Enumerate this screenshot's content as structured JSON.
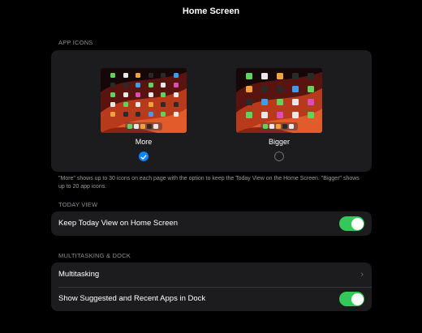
{
  "page": {
    "title": "Home Screen"
  },
  "app_icons": {
    "header": "APP ICONS",
    "options": [
      {
        "label": "More",
        "selected": true
      },
      {
        "label": "Bigger",
        "selected": false
      }
    ],
    "footnote": "\"More\" shows up to 30 icons on each page with the option to keep the Today View on the Home Screen. \"Bigger\" shows up to 20 app icons."
  },
  "today_view": {
    "header": "TODAY VIEW",
    "keep_label": "Keep Today View on Home Screen",
    "keep_enabled": true
  },
  "multitasking_dock": {
    "header": "MULTITASKING & DOCK",
    "multitasking_label": "Multitasking",
    "suggested_label": "Show Suggested and Recent Apps in Dock",
    "suggested_enabled": true
  },
  "colors": {
    "accent": "#0a84ff",
    "toggle_on": "#34c759",
    "card_bg": "#1c1c1e",
    "secondary_text": "#8e8e93"
  }
}
